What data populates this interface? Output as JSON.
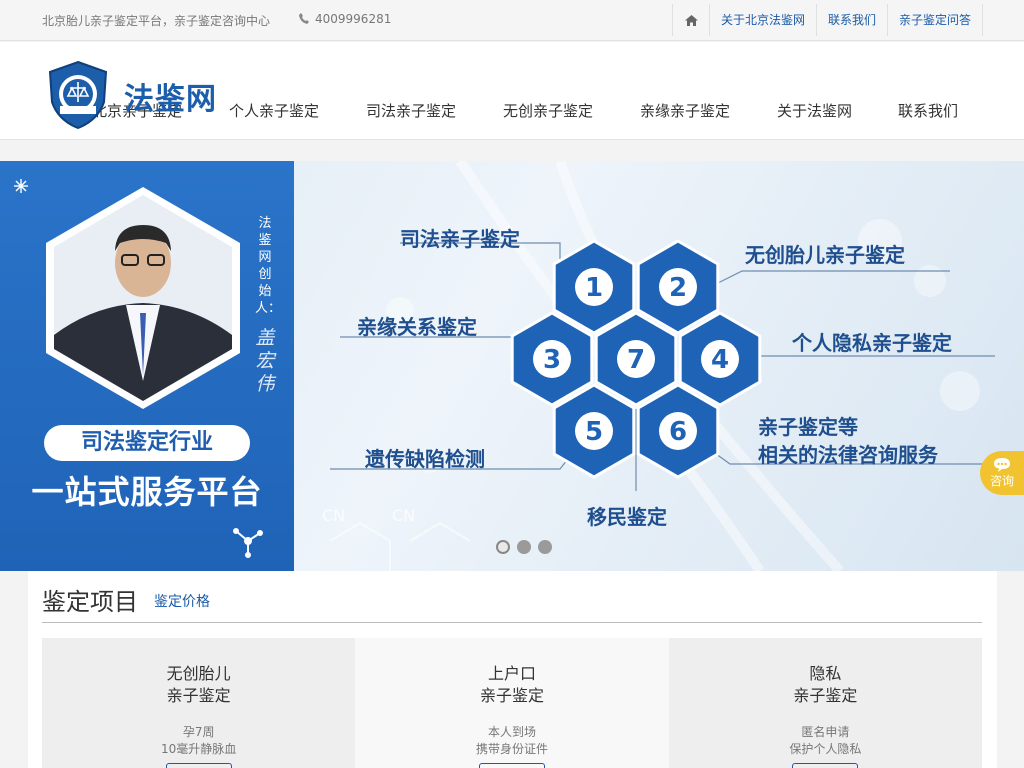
{
  "topbar": {
    "slogan": "北京胎儿亲子鉴定平台，亲子鉴定咨询中心",
    "phone": "4009996281",
    "links": [
      "关于北京法鉴网",
      "联系我们",
      "亲子鉴定问答"
    ]
  },
  "header": {
    "logo_text": "法鉴网",
    "nav": [
      "北京亲子鉴定",
      "个人亲子鉴定",
      "司法亲子鉴定",
      "无创亲子鉴定",
      "亲缘亲子鉴定",
      "关于法鉴网",
      "联系我们"
    ]
  },
  "banner": {
    "founder_label": "法鉴网创始人：",
    "founder_name": "盖宏伟",
    "pill_text": "司法鉴定行业",
    "headline": "一站式服务平台",
    "services": [
      {
        "num": "1",
        "label": "司法亲子鉴定"
      },
      {
        "num": "2",
        "label": "无创胎儿亲子鉴定"
      },
      {
        "num": "3",
        "label": "亲缘关系鉴定"
      },
      {
        "num": "4",
        "label": "个人隐私亲子鉴定"
      },
      {
        "num": "5",
        "label": "遗传缺陷检测"
      },
      {
        "num": "6",
        "label": "亲子鉴定等"
      },
      {
        "num": "7",
        "label": "移民鉴定"
      }
    ],
    "service6_line2": "相关的法律咨询服务",
    "deco": [
      "CN",
      "CN"
    ],
    "slides": 3,
    "active_slide": 1
  },
  "consult": {
    "label": "咨询"
  },
  "section": {
    "title": "鉴定项目",
    "link": "鉴定价格",
    "cards": [
      {
        "line1": "无创胎儿",
        "line2": "亲子鉴定",
        "desc1": "孕7周",
        "desc2": "10毫升静脉血"
      },
      {
        "line1": "上户口",
        "line2": "亲子鉴定",
        "desc1": "本人到场",
        "desc2": "携带身份证件"
      },
      {
        "line1": "隐私",
        "line2": "亲子鉴定",
        "desc1": "匿名申请",
        "desc2": "保护个人隐私"
      }
    ]
  },
  "colors": {
    "brand": "#1d5eaa",
    "consult": "#f2c330",
    "hex": "#1f63b7"
  }
}
